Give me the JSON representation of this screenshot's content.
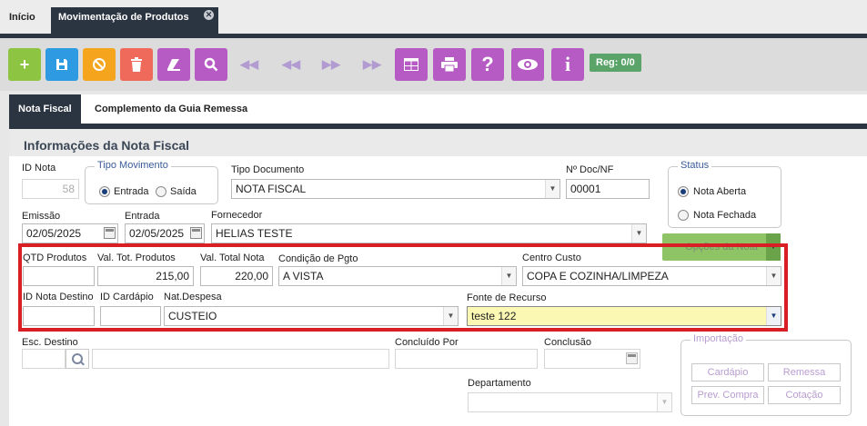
{
  "tabs": {
    "home": "Início",
    "active": "Movimentação de Produtos"
  },
  "toolbar": {
    "colors": {
      "add": "#8dc441",
      "save": "#2e9ae2",
      "cancel": "#f5a41d",
      "delete": "#ef6a5a",
      "purple": "#b65ac4"
    },
    "reg": "Reg: 0/0"
  },
  "subtabs": {
    "nota_fiscal": "Nota Fiscal",
    "complemento": "Complemento da Guia Remessa"
  },
  "section_title": "Informações da Nota Fiscal",
  "fields": {
    "id_nota": {
      "label": "ID Nota",
      "value": "58"
    },
    "tipo_movimento": {
      "legend": "Tipo Movimento",
      "entrada": "Entrada",
      "saida": "Saída",
      "selected": "Entrada"
    },
    "tipo_documento": {
      "label": "Tipo Documento",
      "value": "NOTA FISCAL"
    },
    "nro_doc": {
      "label": "Nº Doc/NF",
      "value": "00001"
    },
    "status": {
      "legend": "Status",
      "aberta": "Nota Aberta",
      "fechada": "Nota Fechada",
      "selected": "Nota Aberta"
    },
    "emissao": {
      "label": "Emissão",
      "value": "02/05/2025"
    },
    "entrada": {
      "label": "Entrada",
      "value": "02/05/2025"
    },
    "fornecedor": {
      "label": "Fornecedor",
      "value": "HELIAS TESTE"
    },
    "opcoes": "Opções da Nota",
    "qtd_produtos": {
      "label": "QTD Produtos",
      "value": ""
    },
    "val_tot_produtos": {
      "label": "Val. Tot. Produtos",
      "value": "215,00"
    },
    "val_total_nota": {
      "label": "Val. Total Nota",
      "value": "220,00"
    },
    "condicao_pgto": {
      "label": "Condição de Pgto",
      "value": "A  VISTA"
    },
    "centro_custo": {
      "label": "Centro Custo",
      "value": "COPA E COZINHA/LIMPEZA"
    },
    "id_nota_destino": {
      "label": "ID Nota Destino",
      "value": ""
    },
    "id_cardapio": {
      "label": "ID Cardápio",
      "value": ""
    },
    "nat_despesa": {
      "label": "Nat.Despesa",
      "value": "CUSTEIO"
    },
    "fonte_recurso": {
      "label": "Fonte de Recurso",
      "value": "teste 122"
    },
    "esc_destino": {
      "label": "Esc. Destino",
      "value": ""
    },
    "concluido_por": {
      "label": "Concluído Por",
      "value": ""
    },
    "conclusao": {
      "label": "Conclusão",
      "value": ""
    },
    "departamento": {
      "label": "Departamento",
      "value": ""
    }
  },
  "importacao": {
    "legend": "Importação",
    "cardapio": "Cardápio",
    "remessa": "Remessa",
    "prev_compra": "Prev. Compra",
    "cotacao": "Cotação"
  }
}
